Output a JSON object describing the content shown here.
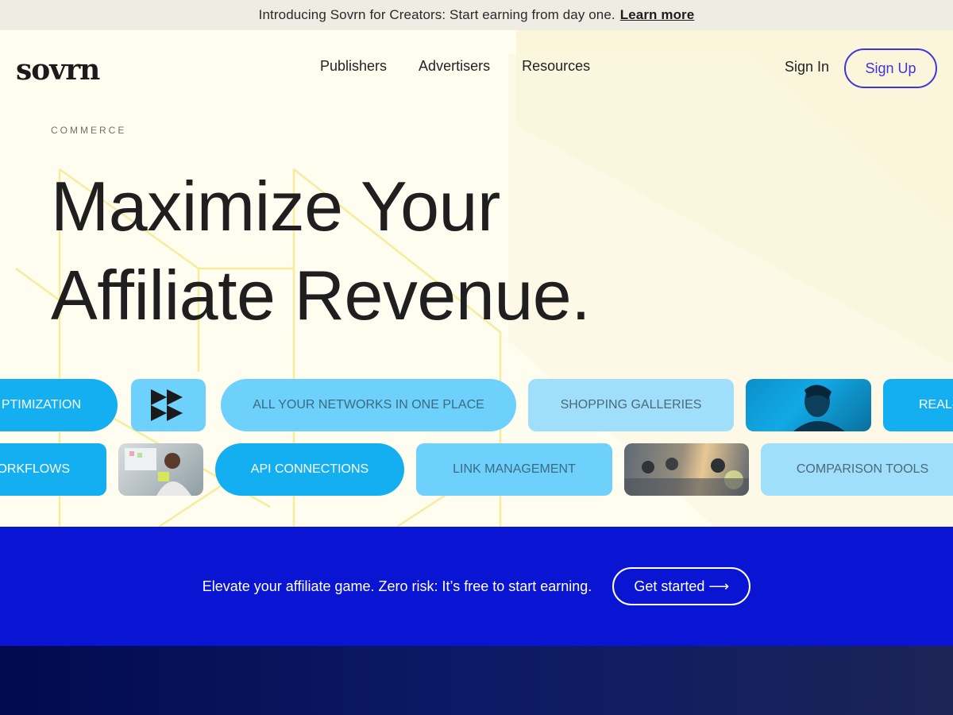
{
  "announcement": {
    "text": "Introducing Sovrn for Creators: Start earning from day one.",
    "link_label": "Learn more"
  },
  "header": {
    "logo": "sovrn",
    "nav": [
      "Publishers",
      "Advertisers",
      "Resources"
    ],
    "sign_in": "Sign In",
    "sign_up": "Sign Up"
  },
  "hero": {
    "eyebrow": "COMMERCE",
    "headline_line1": "Maximize Your",
    "headline_line2": "Affiliate Revenue.",
    "row1": {
      "optimization": "PTIMIZATION",
      "networks": "ALL YOUR NETWORKS IN ONE PLACE",
      "galleries": "SHOPPING GALLERIES",
      "real": "REAL-"
    },
    "row2": {
      "workflows": "ORKFLOWS",
      "api": "API CONNECTIONS",
      "link_mgmt": "LINK MANAGEMENT",
      "comparison": "COMPARISON TOOLS"
    }
  },
  "cta": {
    "text": "Elevate your affiliate game. Zero risk: It’s free to start earning.",
    "button": "Get started ⟶"
  },
  "colors": {
    "accent": "#3f35d6",
    "cta_band": "#0a15d3",
    "pill_blue": "#14aff0",
    "pill_sky": "#6ed1fb",
    "hero_bg": "#fffdef"
  }
}
